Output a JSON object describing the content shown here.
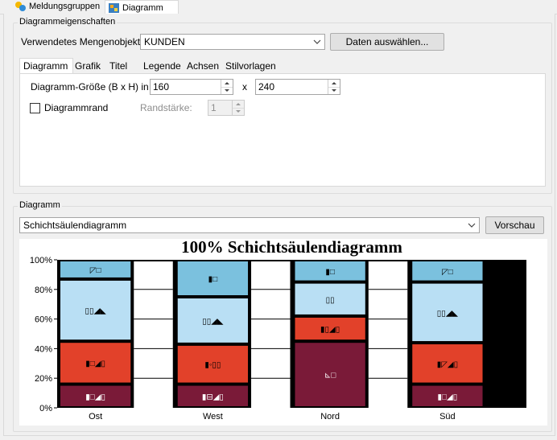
{
  "top_tabs": [
    {
      "label": "Meldungsgruppen",
      "icon": "message-groups-icon"
    },
    {
      "label": "Diagramm",
      "icon": "chart-icon"
    }
  ],
  "props_group": {
    "title": "Diagrammeigenschaften",
    "quantity_label": "Verwendetes Mengenobjekt:",
    "quantity_value": "KUNDEN",
    "select_data_button": "Daten auswählen...",
    "tabs": [
      "Diagramm",
      "Grafik",
      "Titel",
      "Legende",
      "Achsen",
      "Stilvorlagen"
    ],
    "size_label": "Diagramm-Größe (B x H) in mm:",
    "width_value": "160",
    "size_separator": "x",
    "height_value": "240",
    "border_label": "Diagrammrand",
    "border_checked": false,
    "stroke_label": "Randstärke:",
    "stroke_value": "1"
  },
  "diagram_group": {
    "title": "Diagramm",
    "type_value": "Schichtsäulendiagramm",
    "preview_button": "Vorschau"
  },
  "chart_data": {
    "type": "bar",
    "stacked": "percent",
    "title": "100% Schichtsäulendiagramm",
    "categories": [
      "Ost",
      "West",
      "Nord",
      "Süd"
    ],
    "y_ticks": [
      "0%",
      "20%",
      "40%",
      "60%",
      "80%",
      "100%"
    ],
    "ylim": [
      0,
      100
    ],
    "grid": true,
    "series": [
      {
        "color": "#7a1a38",
        "values": [
          16,
          16,
          45,
          16
        ],
        "labels": [
          "▮□◢▯",
          "▮⊟◢▯",
          "⊾□",
          "▮□◢▯"
        ]
      },
      {
        "color": "#e2412a",
        "values": [
          29,
          27,
          17,
          28
        ],
        "labels": [
          "▮□◢▯",
          "▮◦▯▯",
          "▮▯◢▯",
          "▮◸◢▯"
        ]
      },
      {
        "color": "#b9dff4",
        "values": [
          42,
          32,
          23,
          41
        ],
        "labels": [
          "▯▯◢◣",
          "▯▯◢◣",
          "▯▯",
          "▯▯◢◣"
        ]
      },
      {
        "color": "#7bc1de",
        "values": [
          13,
          25,
          15,
          15
        ],
        "labels": [
          "◸□",
          "▮□",
          "▮□",
          "◸□"
        ]
      }
    ]
  },
  "colors": {
    "panel_bg": "#f0f0f0",
    "border": "#d9d9d9",
    "chart_frame": "#000000"
  }
}
